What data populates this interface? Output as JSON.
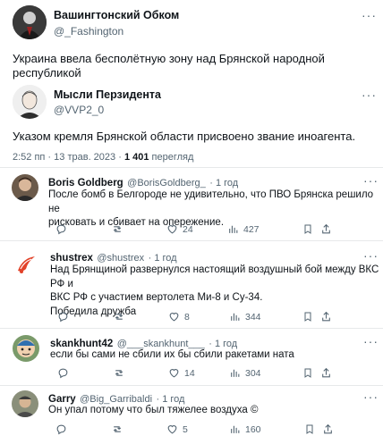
{
  "tweet1": {
    "name": "Вашингтонский Обком",
    "handle": "@_Fashington",
    "text": "Украина ввела бесполётную зону над Брянской народной республикой"
  },
  "tweet2": {
    "name": "Мысли Перзидента",
    "handle": "@VVP2_0",
    "text": "Указом кремля Брянской области присвоено звание иноагента.",
    "time": "2:52 пп · 13 трав. 2023 ·",
    "views_count": "1 401",
    "views_label": "перегляд"
  },
  "replies": [
    {
      "name": "Boris Goldberg",
      "handle": "@BorisGoldberg_",
      "time": "· 1 год",
      "lines": [
        "После бомб в Белгороде не удивительно, что ПВО Брянска решило не",
        "рисковать и сбивает на опережение."
      ],
      "likes": "24",
      "views": "427"
    },
    {
      "name": "shustrex",
      "handle": "@shustrex",
      "time": "· 1 год",
      "lines": [
        "Над Брянщиной развернулся настоящий воздушный бой между ВКС РФ и",
        "ВКС РФ с участием вертолета Ми-8 и Су-34.",
        "Победила дружба"
      ],
      "likes": "8",
      "views": "344"
    },
    {
      "name": "skankhunt42",
      "handle": "@___skankhunt___",
      "time": "· 1 год",
      "lines": [
        "если бы сами не сбили их бы сбили ракетами ната"
      ],
      "likes": "14",
      "views": "304"
    },
    {
      "name": "Garry",
      "handle": "@Big_Garribaldi",
      "time": "· 1 год",
      "lines": [
        "Он упал потому что был тяжелее воздуха ©"
      ],
      "likes": "5",
      "views": "160"
    }
  ],
  "icons": [
    "more-icon",
    "reply-icon",
    "retweet-icon",
    "like-icon",
    "views-icon",
    "bookmark-icon",
    "share-icon"
  ],
  "colors": {
    "text": "#0f1419",
    "secondary": "#536471",
    "divider": "#e7e9ea",
    "accent": "#1d9bf0"
  }
}
